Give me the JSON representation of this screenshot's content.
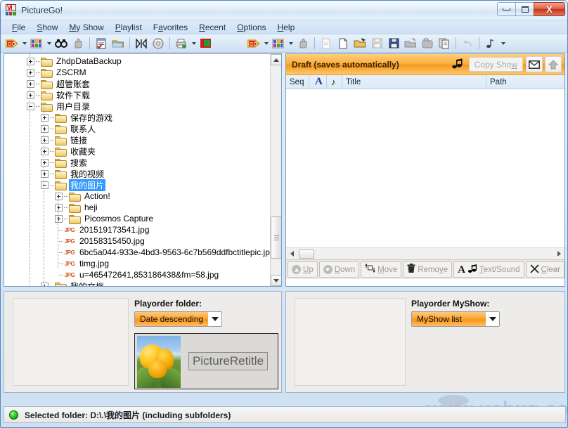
{
  "window": {
    "title": "PictureGo!",
    "app_icon": "picturego-icon",
    "controls": {
      "minimize": "minimize-button",
      "maximize": "maximize-button",
      "close": "close-button",
      "close_glyph": "X"
    }
  },
  "menubar": {
    "items": [
      {
        "label": "File",
        "mnemonic": "F"
      },
      {
        "label": "Show",
        "mnemonic": "S"
      },
      {
        "label": "My Show",
        "mnemonic": "M"
      },
      {
        "label": "Playlist",
        "mnemonic": "P"
      },
      {
        "label": "Favorites",
        "mnemonic": "a"
      },
      {
        "label": "Recent",
        "mnemonic": "R"
      },
      {
        "label": "Options",
        "mnemonic": "O"
      },
      {
        "label": "Help",
        "mnemonic": "H"
      }
    ]
  },
  "toolbar": {
    "left_group": [
      "go-button",
      "go-dropdown",
      "slideshow-button",
      "slideshow-dropdown",
      "find-button",
      "hand-button",
      "separator",
      "checklist-button",
      "open-folder-button",
      "separator",
      "compare-button",
      "disc-button",
      "separator",
      "print-button",
      "print-dropdown",
      "color-button"
    ],
    "right_group": [
      "go-button",
      "go-dropdown",
      "slideshow-button",
      "slideshow-dropdown",
      "hand-button",
      "separator",
      "page-button",
      "new-button",
      "open-button",
      "save-button",
      "save-blue-button",
      "export-button",
      "package-button",
      "copy-button",
      "separator",
      "undo-button",
      "separator",
      "music-button",
      "music-dropdown"
    ]
  },
  "tree": {
    "nodes": [
      {
        "label": "ZhdpDataBackup",
        "depth": 1,
        "icon": "folder-icon",
        "expander": "plus",
        "selected": false
      },
      {
        "label": "ZSCRM",
        "depth": 1,
        "icon": "folder-icon",
        "expander": "plus",
        "selected": false
      },
      {
        "label": "超管账套",
        "depth": 1,
        "icon": "folder-icon",
        "expander": "plus",
        "selected": false
      },
      {
        "label": "软件下载",
        "depth": 1,
        "icon": "folder-icon",
        "expander": "plus",
        "selected": false
      },
      {
        "label": "用户目录",
        "depth": 1,
        "icon": "folder-icon",
        "expander": "minus",
        "selected": false
      },
      {
        "label": "保存的游戏",
        "depth": 2,
        "icon": "folder-icon",
        "expander": "plus",
        "selected": false
      },
      {
        "label": "联系人",
        "depth": 2,
        "icon": "folder-icon",
        "expander": "plus",
        "selected": false
      },
      {
        "label": "链接",
        "depth": 2,
        "icon": "folder-icon",
        "expander": "plus",
        "selected": false
      },
      {
        "label": "收藏夹",
        "depth": 2,
        "icon": "folder-icon",
        "expander": "plus",
        "selected": false
      },
      {
        "label": "搜索",
        "depth": 2,
        "icon": "folder-icon",
        "expander": "plus",
        "selected": false
      },
      {
        "label": "我的视频",
        "depth": 2,
        "icon": "folder-icon",
        "expander": "plus",
        "selected": false
      },
      {
        "label": "我的图片",
        "depth": 2,
        "icon": "folder-icon",
        "expander": "minus",
        "selected": true
      },
      {
        "label": "Action!",
        "depth": 3,
        "icon": "folder-icon",
        "expander": "plus",
        "selected": false
      },
      {
        "label": "heji",
        "depth": 3,
        "icon": "folder-icon",
        "expander": "plus",
        "selected": false
      },
      {
        "label": "Picosmos Capture",
        "depth": 3,
        "icon": "folder-icon",
        "expander": "plus",
        "selected": false
      },
      {
        "label": "201519173541.jpg",
        "depth": 3,
        "icon": "jpg-file-icon",
        "expander": "none",
        "selected": false
      },
      {
        "label": "20158315450.jpg",
        "depth": 3,
        "icon": "jpg-file-icon",
        "expander": "none",
        "selected": false
      },
      {
        "label": "6bc5a044-933e-4bd3-9563-6c7b569ddfbctitlepic.jpg",
        "depth": 3,
        "icon": "jpg-file-icon",
        "expander": "none",
        "selected": false
      },
      {
        "label": "timg.jpg",
        "depth": 3,
        "icon": "jpg-file-icon",
        "expander": "none",
        "selected": false
      },
      {
        "label": "u=465472641,853186438&fm=58.jpg",
        "depth": 3,
        "icon": "jpg-file-icon",
        "expander": "none",
        "selected": false
      },
      {
        "label": "我的文档",
        "depth": 2,
        "icon": "folder-icon",
        "expander": "plus",
        "selected": false
      }
    ]
  },
  "draft_panel": {
    "title": "Draft (saves automatically)",
    "music_icon": "music-note-icon",
    "copy_show_label": "Copy Show",
    "copy_show_mnemonic": "w",
    "mail_button": "mail-icon",
    "upload_button": "upload-arrow-icon",
    "columns": [
      {
        "label": "Seq",
        "name": "column-seq"
      },
      {
        "label": "A",
        "name": "column-text"
      },
      {
        "label": "♪",
        "name": "column-sound"
      },
      {
        "label": "Title",
        "name": "column-title"
      },
      {
        "label": "Path",
        "name": "column-path"
      }
    ],
    "rows": [],
    "actions": [
      {
        "label": "Up",
        "mnemonic": "U",
        "icon": "circle-arrow-up-icon",
        "name": "up-button"
      },
      {
        "label": "Down",
        "mnemonic": "D",
        "icon": "circle-arrow-down-icon",
        "name": "down-button"
      },
      {
        "label": "Move",
        "mnemonic": "M",
        "icon": "move-icon",
        "name": "move-button"
      },
      {
        "label": "Remove",
        "mnemonic": "v",
        "icon": "trash-icon",
        "name": "remove-button"
      },
      {
        "label": "Text/Sound",
        "mnemonic": "T",
        "icon": "text-sound-icon",
        "name": "text-sound-button"
      },
      {
        "label": "Clear",
        "mnemonic": "C",
        "icon": "x-icon",
        "name": "clear-button"
      }
    ]
  },
  "playorder_folder": {
    "label": "Playorder folder:",
    "selected": "Date descending",
    "options": [
      "Date descending"
    ],
    "retitle_button": "PictureRetitle",
    "thumbnail": "tulip-thumbnail"
  },
  "playorder_myshow": {
    "label": "Playorder MyShow:",
    "selected": "MyShow list",
    "options": [
      "MyShow list"
    ]
  },
  "statusbar": {
    "led": "status-led-green",
    "text": "Selected folder: D:\\.\\我的图片  (including subfolders)"
  },
  "watermark": {
    "text": "www.ucbug.com"
  },
  "colors": {
    "accent_orange": "#f7941d",
    "header_orange": "#fbb040",
    "selection_blue": "#3399ff",
    "window_border": "#5a87b8",
    "status_green": "#2ecc2e"
  }
}
